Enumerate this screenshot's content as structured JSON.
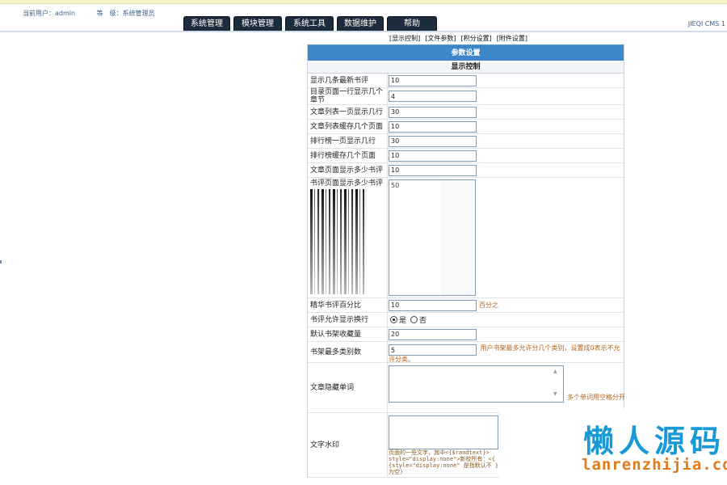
{
  "header": {
    "user_label": "当前用户：admin",
    "level_label": "等　级：系统管理员",
    "cms_name": "JIEQI CMS 1"
  },
  "nav": {
    "tabs": [
      "系统管理",
      "模块管理",
      "系统工具",
      "数据维护",
      "帮助"
    ]
  },
  "submenu": [
    "[显示控制]",
    "[文件参数]",
    "[积分设置]",
    "[附件设置]"
  ],
  "panel": {
    "title": "参数设置",
    "section": "显示控制",
    "rows": [
      {
        "label": "显示几条最新书评",
        "value": "10"
      },
      {
        "label": "目录页面一行显示几个章节",
        "value": "4"
      },
      {
        "label": "文章列表一页显示几行",
        "value": "30"
      },
      {
        "label": "文章列表缓存几个页面",
        "value": "10"
      },
      {
        "label": "排行榜一页显示几行",
        "value": "30"
      },
      {
        "label": "排行榜缓存几个页面",
        "value": "10"
      },
      {
        "label": "文章页面显示多少书评",
        "value": "10"
      }
    ],
    "review_page": {
      "label": "书评页面显示多少书评",
      "value": "50"
    },
    "essence": {
      "label": "精华书评百分比",
      "value": "10",
      "unit": "百分之"
    },
    "wrap": {
      "label": "书评允许显示换行",
      "yes": "是",
      "no": "否",
      "selected": "yes"
    },
    "shelf_default": {
      "label": "默认书架收藏量",
      "value": "20"
    },
    "shelf_max": {
      "label": "书架最多类别数",
      "value": "5",
      "tip": "用户书架最多允许分几个类别，设置成0表示不允许分类。"
    },
    "hidden_words": {
      "label": "文章隐藏单词",
      "value": "",
      "tip": "多个单词用空格分开"
    },
    "watermark": {
      "label": "文字水印",
      "value": "",
      "tip": "页面的一些文字，其中<{$randtext}> style=\"display:none\">新校所有：<{ {style=\"display:none\" 是指默认不 }为空)"
    }
  },
  "overlay": {
    "cn": "懒人源码",
    "url": "lanrenzhijia.com"
  }
}
